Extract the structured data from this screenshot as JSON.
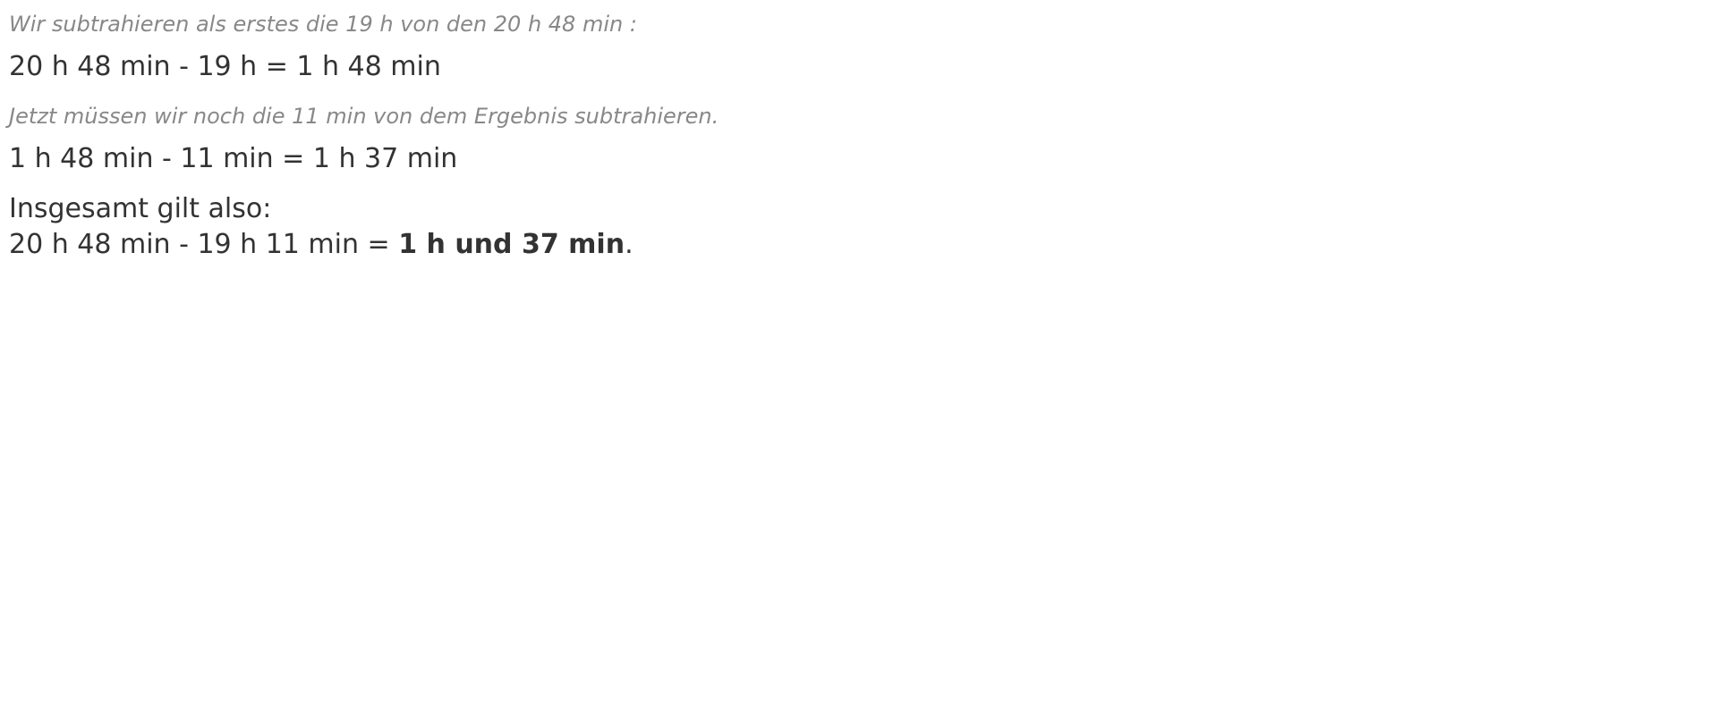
{
  "steps": [
    {
      "hint": "Wir subtrahieren als erstes die 19 h von den 20 h 48 min :",
      "equation": "20 h 48 min - 19 h = 1 h 48 min"
    },
    {
      "hint": "Jetzt müssen wir noch die 11 min von dem Ergebnis subtrahieren.",
      "equation": "1 h 48 min - 11 min = 1 h 37 min"
    }
  ],
  "summary": {
    "intro": "Insgesamt gilt also:",
    "equation_prefix": "20 h 48 min - 19 h 11 min = ",
    "result": "1 h und 37 min",
    "suffix": "."
  }
}
